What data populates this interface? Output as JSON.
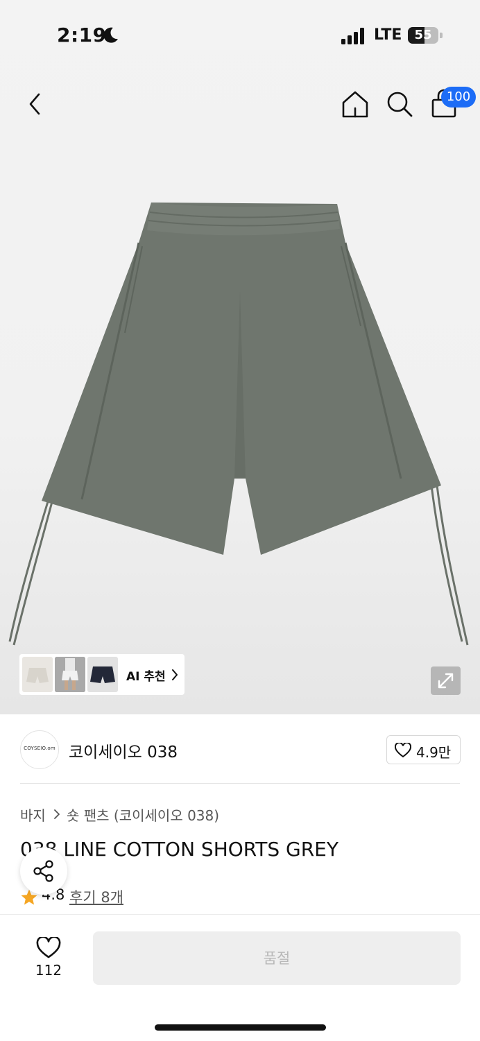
{
  "status_bar": {
    "time": "2:19",
    "network": "LTE",
    "battery": "55",
    "battery_level_percent": 55,
    "icons": [
      "moon-icon",
      "signal-icon"
    ]
  },
  "top_nav": {
    "cart_badge": "100",
    "icons": [
      "back-chevron-icon",
      "home-icon",
      "search-icon",
      "shopping-bag-icon"
    ]
  },
  "ai_recommend": {
    "label": "AI 추천"
  },
  "brand": {
    "logo_text": "COYSEIO.om",
    "name": "코이세이오 038",
    "likes": "4.9만"
  },
  "breadcrumb": {
    "category": "바지",
    "subcategory": "숏 팬츠 (코이세이오 038)"
  },
  "product": {
    "title": "038 LINE COTTON SHORTS GREY",
    "rating": "4.8",
    "reviews": "후기 8개"
  },
  "bottom_bar": {
    "wish_count": "112",
    "soldout_label": "품절"
  },
  "colors": {
    "accent": "#1c6cf6",
    "star": "#f5a623",
    "shorts": "#6e756d",
    "soldout_bg": "#eeeeee"
  }
}
